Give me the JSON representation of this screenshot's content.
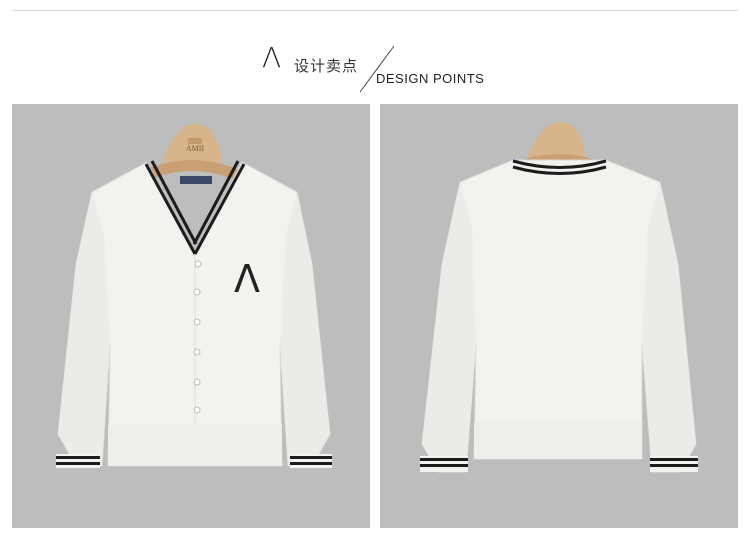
{
  "header": {
    "logo_mark": "Λ",
    "title_cn": "设计卖点",
    "title_en": "DESIGN POINTS"
  },
  "front_image": {
    "hanger_brand": "AMII",
    "chest_logo": "Λ"
  },
  "colors": {
    "background": "#ffffff",
    "panel": "#bcbdbd",
    "sweater": "#f3f2ef",
    "stripe": "#1c1c1c",
    "hanger": "#d8b48a"
  }
}
